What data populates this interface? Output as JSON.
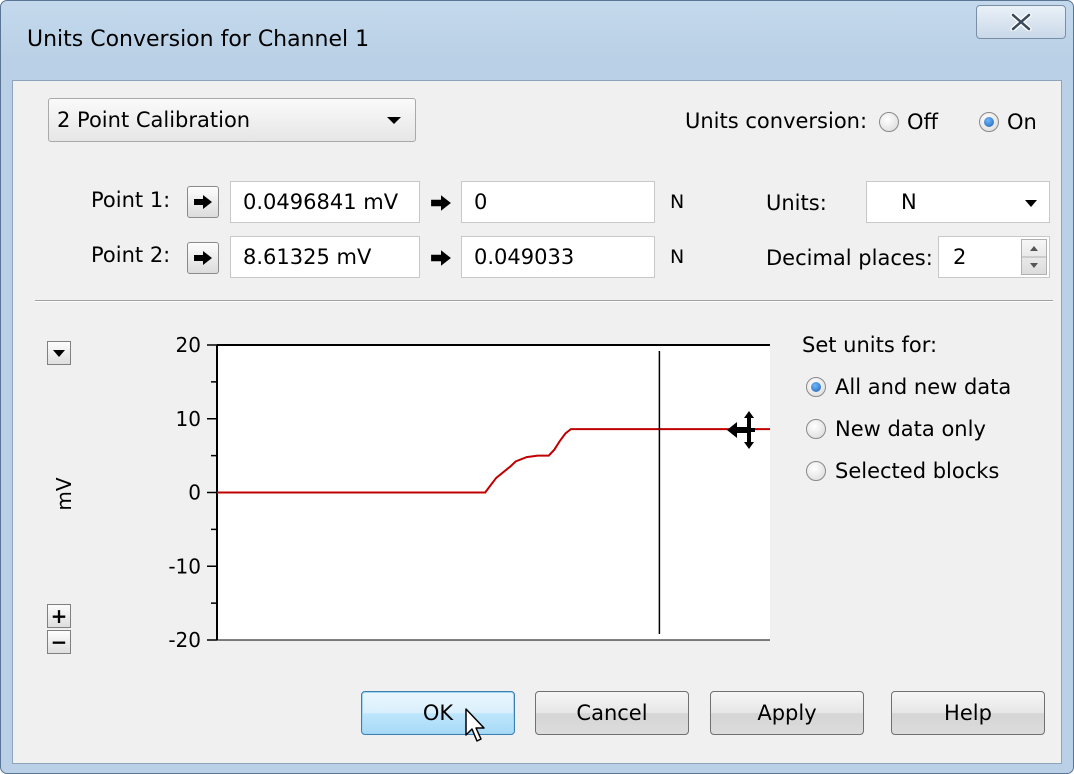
{
  "window": {
    "title": "Units Conversion for Channel 1"
  },
  "calibration": {
    "mode": "2 Point Calibration"
  },
  "units_conversion": {
    "label": "Units conversion:",
    "off_label": "Off",
    "on_label": "On",
    "selected": "On"
  },
  "points": [
    {
      "label": "Point 1:",
      "raw": "0.0496841 mV",
      "converted": "0",
      "unit": "N"
    },
    {
      "label": "Point 2:",
      "raw": "8.61325 mV",
      "converted": "0.049033",
      "unit": "N"
    }
  ],
  "units": {
    "label": "Units:",
    "value": "N"
  },
  "decimals": {
    "label": "Decimal places:",
    "value": "2"
  },
  "set_units": {
    "title": "Set units for:",
    "options": [
      "All and new data",
      "New data only",
      "Selected blocks"
    ],
    "selected": "All and new data"
  },
  "buttons": {
    "ok": "OK",
    "cancel": "Cancel",
    "apply": "Apply",
    "help": "Help"
  },
  "zoom": {
    "plus": "+",
    "minus": "−"
  },
  "chart_data": {
    "type": "line",
    "title": "",
    "xlabel": "",
    "ylabel": "mV",
    "ylim": [
      -20,
      20
    ],
    "xlim": [
      0,
      100
    ],
    "yticks": [
      20,
      10,
      0,
      -10,
      -20
    ],
    "tick_labels": [
      "20",
      "10",
      "0",
      "-10",
      "-20"
    ],
    "series": [
      {
        "color": "#c00000",
        "x": [
          0,
          48.5,
          49.5,
          50.5,
          53,
          54,
          56,
          58,
          60,
          61,
          62,
          63,
          64,
          65,
          66,
          100
        ],
        "y": [
          0,
          0,
          1,
          2,
          3.5,
          4.2,
          4.8,
          5,
          5,
          5.8,
          7,
          8,
          8.6,
          8.6,
          8.6,
          8.6
        ]
      }
    ],
    "cursor_x": 80,
    "grid": false
  },
  "colors": {
    "line": "#c00000",
    "accent": "#3c7fb1"
  }
}
